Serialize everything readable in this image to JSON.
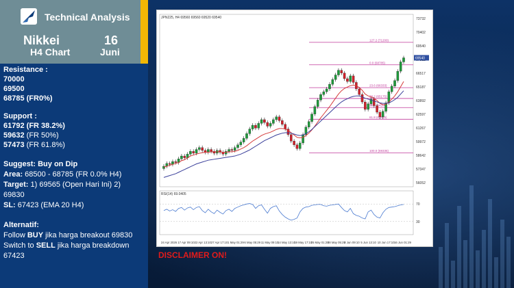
{
  "header": {
    "title": "Technical Analysis",
    "instrument": "Nikkei",
    "chart_type": "H4 Chart",
    "date_day": "16",
    "date_month": "Juni"
  },
  "analysis": {
    "resistance_title": "Resistance :",
    "resistance": [
      "70000",
      "69500",
      "68785 (FR0%)"
    ],
    "support_title": "Support :",
    "support": [
      {
        "value": "61792",
        "note": " (FR 38.2%)"
      },
      {
        "value": "59632",
        "note": " (FR 50%)"
      },
      {
        "value": "57473",
        "note": " (FR 61.8%)"
      }
    ],
    "suggest_label": "Suggest: Buy on Dip",
    "area_label": "Area:",
    "area_value": " 68500 - 68785 (FR 0.0% H4)",
    "target_label": "Target:",
    "target_value": " 1) 69565 (Open Hari Ini) 2)",
    "target_value_2": "69830",
    "sl_label": "SL:",
    "sl_value": " 67423 (EMA 20 H4)",
    "alt_title": "Alternatif:",
    "alt_line1_a": "Follow ",
    "alt_line1_b": "BUY",
    "alt_line1_c": " jika harga breakout 69830",
    "alt_line2_a": "Switch to ",
    "alt_line2_b": "SELL",
    "alt_line2_c": " jika harga breakdown",
    "alt_line3": "67423"
  },
  "disclaimer": "DISCLAIMER ON!",
  "chart_data": {
    "type": "candlestick",
    "header_text": "JPN225, H4  69560 69560 69520 69540",
    "indicator_label": "RSI(14) 69.0405",
    "y_ticks": [
      "73732",
      "70402",
      "69540",
      "67812",
      "66517",
      "65187",
      "63892",
      "62597",
      "61267",
      "59972",
      "58642",
      "57347",
      "56052"
    ],
    "x_ticks": [
      "24 Apr 2026",
      "17 Apr 09:10",
      "22 Apr 13:10",
      "27 Apr 17:10",
      "1 May 01:29",
      "6 May 05:29",
      "11 May 09:10",
      "14 May 13:10",
      "19 May 17:10",
      "25 May 01:29",
      "28 May 05:29",
      "2 Jun 09:10",
      "5 Jun 13:10",
      "10 Jun 17:10",
      "16 Jun 01:29"
    ],
    "rsi_ticks": [
      "70",
      "30"
    ],
    "fib_levels": [
      {
        "label": "127.2 (71200)",
        "price": 71200
      },
      {
        "label": "0.0 (68785)",
        "price": 68785
      },
      {
        "label": "23.6 (66333)",
        "price": 66333
      },
      {
        "label": "38.2 (65175)",
        "price": 65175
      },
      {
        "label": "50.0 (64200)",
        "price": 64200
      },
      {
        "label": "61.8 (62945)",
        "price": 62945
      },
      {
        "label": "100.0 (59335)",
        "price": 59335
      }
    ],
    "close": [
      57900,
      58200,
      58100,
      58400,
      58300,
      58700,
      59000,
      58800,
      59200,
      59500,
      59300,
      59700,
      59900,
      59600,
      59400,
      59700,
      59500,
      59300,
      59600,
      59400,
      59200,
      59500,
      59700,
      59600,
      59900,
      60200,
      60500,
      60900,
      61400,
      61900,
      62300,
      62000,
      62500,
      62900,
      62600,
      62200,
      62500,
      62900,
      63200,
      62800,
      62400,
      61900,
      61300,
      60600,
      60200,
      59800,
      60400,
      61300,
      62100,
      62700,
      63500,
      64300,
      65000,
      65600,
      65900,
      66200,
      66700,
      67200,
      67700,
      68200,
      67900,
      67300,
      67000,
      67600,
      66900,
      66200,
      65600,
      64800,
      64000,
      64600,
      65100,
      64400,
      63700,
      63200,
      63800,
      64700,
      65900,
      66500,
      67100,
      68100,
      69100,
      69540
    ],
    "ema_fast": [
      57800,
      57900,
      58000,
      58100,
      58200,
      58300,
      58500,
      58600,
      58800,
      59000,
      59100,
      59200,
      59300,
      59350,
      59400,
      59400,
      59450,
      59450,
      59450,
      59450,
      59400,
      59400,
      59450,
      59450,
      59500,
      59600,
      59750,
      59900,
      60100,
      60350,
      60600,
      60800,
      61000,
      61200,
      61350,
      61450,
      61550,
      61700,
      61850,
      61950,
      61950,
      61900,
      61750,
      61500,
      61250,
      61000,
      60950,
      61000,
      61200,
      61450,
      61800,
      62200,
      62650,
      63100,
      63500,
      63900,
      64300,
      64750,
      65200,
      65650,
      66000,
      66250,
      66400,
      66550,
      66600,
      66550,
      66350,
      66050,
      65650,
      65450,
      65350,
      65200,
      64950,
      64650,
      64500,
      64550,
      64800,
      65100,
      65450,
      65900,
      66450,
      67000
    ],
    "ema_slow": [
      56700,
      56800,
      56900,
      57000,
      57100,
      57250,
      57400,
      57550,
      57700,
      57850,
      58000,
      58150,
      58250,
      58350,
      58450,
      58550,
      58600,
      58650,
      58700,
      58750,
      58800,
      58850,
      58900,
      58950,
      59000,
      59100,
      59200,
      59350,
      59500,
      59650,
      59850,
      60050,
      60250,
      60450,
      60650,
      60800,
      60950,
      61100,
      61250,
      61350,
      61450,
      61500,
      61500,
      61450,
      61350,
      61250,
      61200,
      61250,
      61400,
      61600,
      61850,
      62150,
      62450,
      62750,
      63050,
      63350,
      63650,
      63950,
      64250,
      64550,
      64800,
      65000,
      65150,
      65300,
      65400,
      65450,
      65450,
      65350,
      65200,
      65100,
      65000,
      64900,
      64800,
      64700,
      64650,
      64650,
      64700,
      64850,
      65050,
      65300,
      65650,
      66000
    ],
    "rsi": [
      55,
      58,
      54,
      57,
      53,
      60,
      62,
      56,
      61,
      63,
      57,
      62,
      64,
      55,
      50,
      58,
      52,
      48,
      56,
      51,
      47,
      55,
      58,
      53,
      60,
      63,
      66,
      68,
      70,
      71,
      69,
      60,
      66,
      68,
      58,
      49,
      60,
      64,
      66,
      54,
      46,
      40,
      36,
      33,
      35,
      38,
      52,
      60,
      63,
      64,
      67,
      68,
      69,
      69,
      66,
      65,
      67,
      68,
      69,
      70,
      62,
      55,
      52,
      60,
      48,
      44,
      42,
      38,
      36,
      52,
      56,
      46,
      40,
      38,
      50,
      58,
      62,
      63,
      64,
      66,
      68,
      69
    ]
  }
}
